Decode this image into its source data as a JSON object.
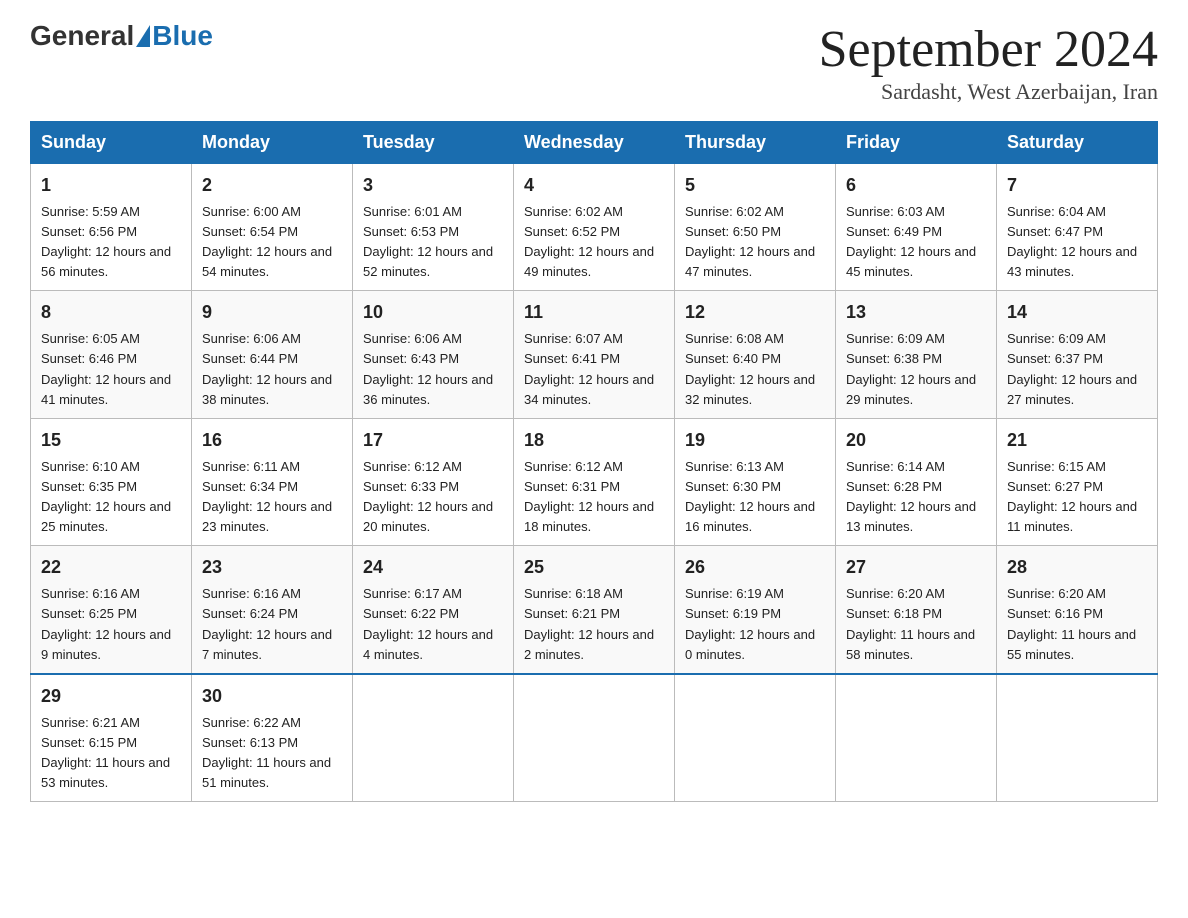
{
  "header": {
    "logo_general": "General",
    "logo_blue": "Blue",
    "month_year": "September 2024",
    "location": "Sardasht, West Azerbaijan, Iran"
  },
  "days_of_week": [
    "Sunday",
    "Monday",
    "Tuesday",
    "Wednesday",
    "Thursday",
    "Friday",
    "Saturday"
  ],
  "weeks": [
    [
      {
        "day": "1",
        "sunrise": "5:59 AM",
        "sunset": "6:56 PM",
        "daylight": "12 hours and 56 minutes."
      },
      {
        "day": "2",
        "sunrise": "6:00 AM",
        "sunset": "6:54 PM",
        "daylight": "12 hours and 54 minutes."
      },
      {
        "day": "3",
        "sunrise": "6:01 AM",
        "sunset": "6:53 PM",
        "daylight": "12 hours and 52 minutes."
      },
      {
        "day": "4",
        "sunrise": "6:02 AM",
        "sunset": "6:52 PM",
        "daylight": "12 hours and 49 minutes."
      },
      {
        "day": "5",
        "sunrise": "6:02 AM",
        "sunset": "6:50 PM",
        "daylight": "12 hours and 47 minutes."
      },
      {
        "day": "6",
        "sunrise": "6:03 AM",
        "sunset": "6:49 PM",
        "daylight": "12 hours and 45 minutes."
      },
      {
        "day": "7",
        "sunrise": "6:04 AM",
        "sunset": "6:47 PM",
        "daylight": "12 hours and 43 minutes."
      }
    ],
    [
      {
        "day": "8",
        "sunrise": "6:05 AM",
        "sunset": "6:46 PM",
        "daylight": "12 hours and 41 minutes."
      },
      {
        "day": "9",
        "sunrise": "6:06 AM",
        "sunset": "6:44 PM",
        "daylight": "12 hours and 38 minutes."
      },
      {
        "day": "10",
        "sunrise": "6:06 AM",
        "sunset": "6:43 PM",
        "daylight": "12 hours and 36 minutes."
      },
      {
        "day": "11",
        "sunrise": "6:07 AM",
        "sunset": "6:41 PM",
        "daylight": "12 hours and 34 minutes."
      },
      {
        "day": "12",
        "sunrise": "6:08 AM",
        "sunset": "6:40 PM",
        "daylight": "12 hours and 32 minutes."
      },
      {
        "day": "13",
        "sunrise": "6:09 AM",
        "sunset": "6:38 PM",
        "daylight": "12 hours and 29 minutes."
      },
      {
        "day": "14",
        "sunrise": "6:09 AM",
        "sunset": "6:37 PM",
        "daylight": "12 hours and 27 minutes."
      }
    ],
    [
      {
        "day": "15",
        "sunrise": "6:10 AM",
        "sunset": "6:35 PM",
        "daylight": "12 hours and 25 minutes."
      },
      {
        "day": "16",
        "sunrise": "6:11 AM",
        "sunset": "6:34 PM",
        "daylight": "12 hours and 23 minutes."
      },
      {
        "day": "17",
        "sunrise": "6:12 AM",
        "sunset": "6:33 PM",
        "daylight": "12 hours and 20 minutes."
      },
      {
        "day": "18",
        "sunrise": "6:12 AM",
        "sunset": "6:31 PM",
        "daylight": "12 hours and 18 minutes."
      },
      {
        "day": "19",
        "sunrise": "6:13 AM",
        "sunset": "6:30 PM",
        "daylight": "12 hours and 16 minutes."
      },
      {
        "day": "20",
        "sunrise": "6:14 AM",
        "sunset": "6:28 PM",
        "daylight": "12 hours and 13 minutes."
      },
      {
        "day": "21",
        "sunrise": "6:15 AM",
        "sunset": "6:27 PM",
        "daylight": "12 hours and 11 minutes."
      }
    ],
    [
      {
        "day": "22",
        "sunrise": "6:16 AM",
        "sunset": "6:25 PM",
        "daylight": "12 hours and 9 minutes."
      },
      {
        "day": "23",
        "sunrise": "6:16 AM",
        "sunset": "6:24 PM",
        "daylight": "12 hours and 7 minutes."
      },
      {
        "day": "24",
        "sunrise": "6:17 AM",
        "sunset": "6:22 PM",
        "daylight": "12 hours and 4 minutes."
      },
      {
        "day": "25",
        "sunrise": "6:18 AM",
        "sunset": "6:21 PM",
        "daylight": "12 hours and 2 minutes."
      },
      {
        "day": "26",
        "sunrise": "6:19 AM",
        "sunset": "6:19 PM",
        "daylight": "12 hours and 0 minutes."
      },
      {
        "day": "27",
        "sunrise": "6:20 AM",
        "sunset": "6:18 PM",
        "daylight": "11 hours and 58 minutes."
      },
      {
        "day": "28",
        "sunrise": "6:20 AM",
        "sunset": "6:16 PM",
        "daylight": "11 hours and 55 minutes."
      }
    ],
    [
      {
        "day": "29",
        "sunrise": "6:21 AM",
        "sunset": "6:15 PM",
        "daylight": "11 hours and 53 minutes."
      },
      {
        "day": "30",
        "sunrise": "6:22 AM",
        "sunset": "6:13 PM",
        "daylight": "11 hours and 51 minutes."
      },
      null,
      null,
      null,
      null,
      null
    ]
  ]
}
